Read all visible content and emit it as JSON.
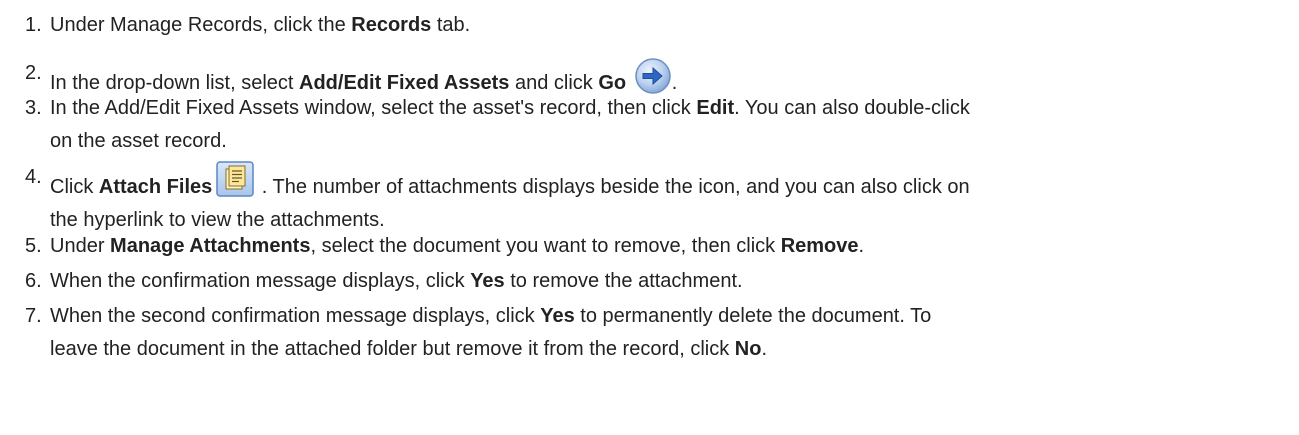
{
  "steps": [
    {
      "num": "1.",
      "parts": [
        "Under Manage Records, click the ",
        "Records",
        " tab."
      ]
    },
    {
      "num": "2.",
      "parts": [
        "In the drop-down list, select ",
        "Add/Edit Fixed Assets",
        " and click ",
        "Go",
        " ",
        "."
      ]
    },
    {
      "num": "3.",
      "parts": [
        "In the Add/Edit Fixed Assets window, select the asset's record, then click ",
        "Edit",
        ". You can also double-click",
        "on the asset record."
      ]
    },
    {
      "num": "4.",
      "parts": [
        "Click ",
        "Attach Files",
        " . The number of attachments displays beside the icon, and you can also click on",
        "the hyperlink to view the attachments."
      ]
    },
    {
      "num": "5.",
      "parts": [
        "Under ",
        "Manage Attachments",
        ", select the document you want to remove, then click ",
        "Remove",
        "."
      ]
    },
    {
      "num": "6.",
      "parts": [
        "When the confirmation message displays, click ",
        "Yes",
        " to remove the attachment."
      ]
    },
    {
      "num": "7.",
      "parts": [
        "When the second confirmation message displays, click ",
        "Yes",
        " to permanently delete the document. To",
        "leave the document in the attached folder but remove it from the record, click ",
        "No",
        "."
      ]
    }
  ],
  "icons": {
    "go": "go-arrow-icon",
    "attach": "attach-files-icon"
  },
  "colors": {
    "text": "#222222",
    "go_blue": "#3a73c8",
    "attach_blue": "#5b93d6"
  }
}
